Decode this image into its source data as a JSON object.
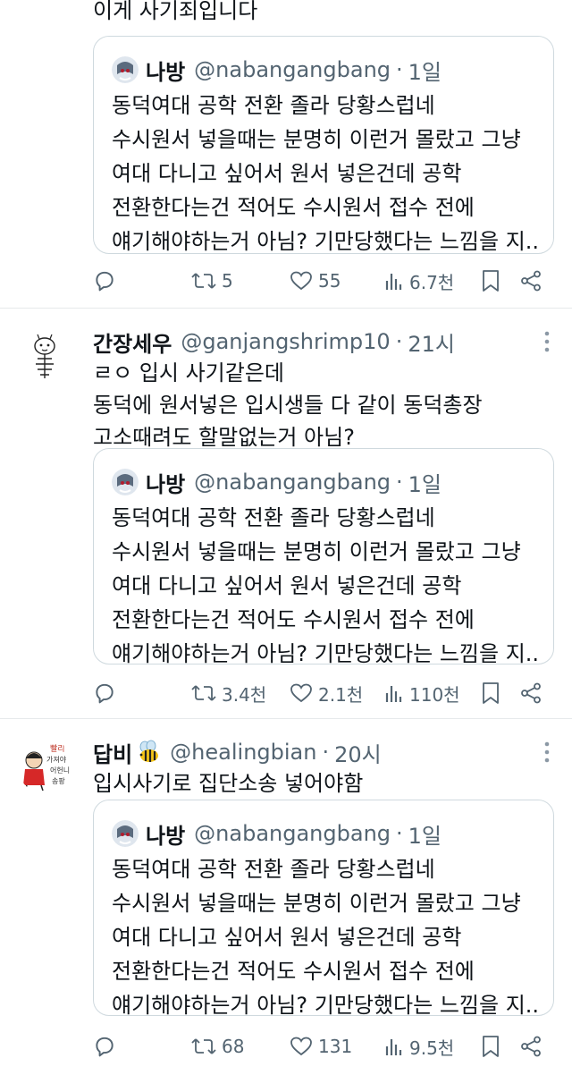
{
  "tweets": [
    {
      "body_lines": [
        "이게 사기죄입니다"
      ],
      "quote": {
        "name": "나방",
        "handle": "@nabangangbang",
        "dot": "·",
        "time": "1일",
        "lines": [
          "동덕여대 공학 전환 졸라 당황스럽네",
          "수시원서 넣을때는 분명히 이런거 몰랐고 그냥",
          "여대 다니고 싶어서 원서 넣은건데 공학",
          "전환한다는건 적어도 수시원서 접수 전에",
          "얘기해야하는거 아님? 기만당했다는 느낌을 지..."
        ]
      },
      "stats": {
        "retweets": "5",
        "likes": "55",
        "views": "6.7천"
      }
    },
    {
      "name": "간장세우",
      "handle": "@ganjangshrimp10",
      "dot": "·",
      "time": "21시",
      "body_lines": [
        "ㄹㅇ 입시 사기같은데",
        "동덕에 원서넣은 입시생들 다 같이 동덕총장",
        "고소때려도 할말없는거 아님?"
      ],
      "quote": {
        "name": "나방",
        "handle": "@nabangangbang",
        "dot": "·",
        "time": "1일",
        "lines": [
          "동덕여대 공학 전환 졸라 당황스럽네",
          "수시원서 넣을때는 분명히 이런거 몰랐고 그냥",
          "여대 다니고 싶어서 원서 넣은건데 공학",
          "전환한다는건 적어도 수시원서 접수 전에",
          "얘기해야하는거 아님? 기만당했다는 느낌을 지..."
        ]
      },
      "stats": {
        "retweets": "3.4천",
        "likes": "2.1천",
        "views": "110천"
      }
    },
    {
      "name": "답비",
      "handle": "@healingbian",
      "dot": "·",
      "time": "20시",
      "avatar_text": [
        "빨리",
        "가져야",
        "어헌니",
        "송팡"
      ],
      "body_lines": [
        "입시사기로 집단소송 넣어야함"
      ],
      "quote": {
        "name": "나방",
        "handle": "@nabangangbang",
        "dot": "·",
        "time": "1일",
        "lines": [
          "동덕여대 공학 전환 졸라 당황스럽네",
          "수시원서 넣을때는 분명히 이런거 몰랐고 그냥",
          "여대 다니고 싶어서 원서 넣은건데 공학",
          "전환한다는건 적어도 수시원서 접수 전에",
          "얘기해야하는거 아님? 기만당했다는 느낌을 지..."
        ]
      },
      "stats": {
        "retweets": "68",
        "likes": "131",
        "views": "9.5천"
      }
    }
  ],
  "icons": [
    "reply-icon",
    "retweet-icon",
    "heart-icon",
    "views-icon",
    "bookmark-icon",
    "share-icon",
    "more-icon"
  ],
  "colors": {
    "text": "#0f1419",
    "muted": "#536471",
    "border": "#cfd9de",
    "divider": "#e6e9eb"
  }
}
